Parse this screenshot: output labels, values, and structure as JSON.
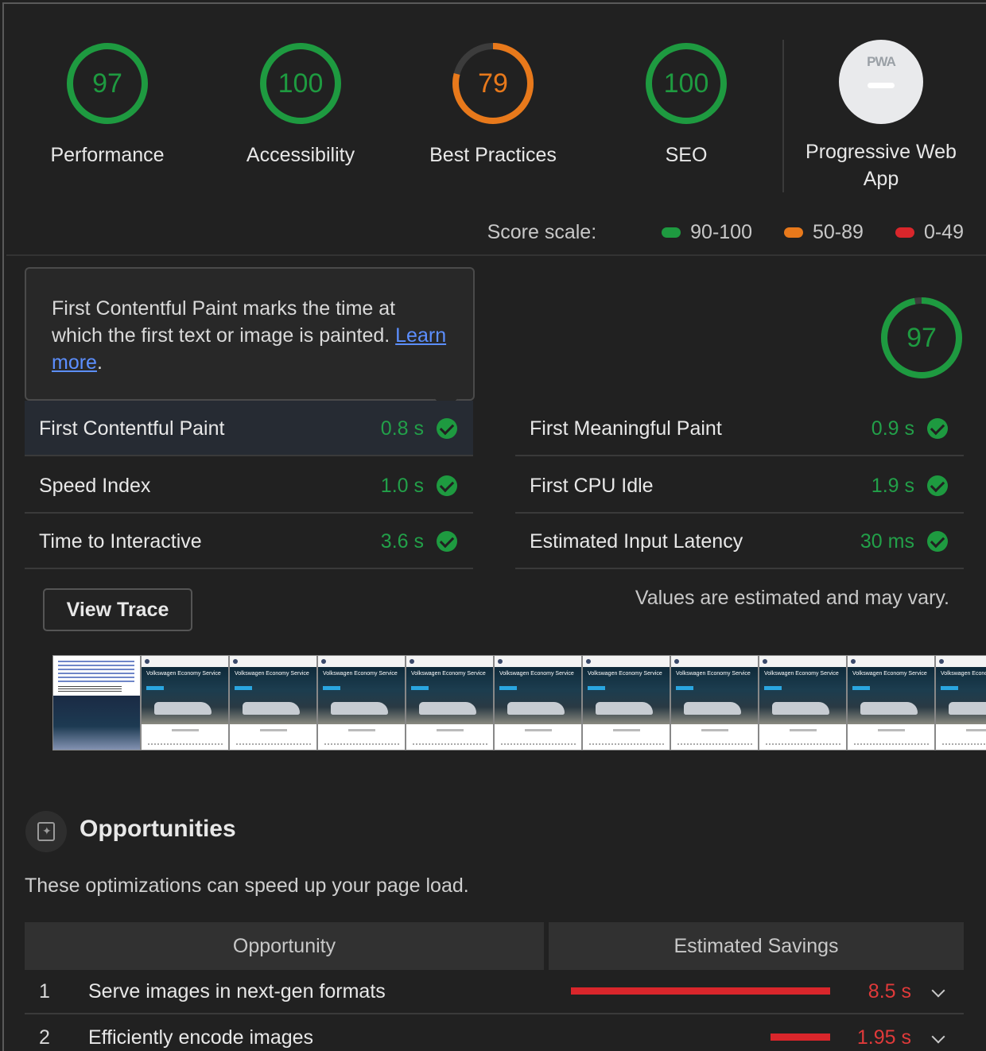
{
  "categories": [
    {
      "label": "Performance",
      "score": "97",
      "color": "#1e9a40"
    },
    {
      "label": "Accessibility",
      "score": "100",
      "color": "#1e9a40"
    },
    {
      "label": "Best Practices",
      "score": "79",
      "color": "#e8791b"
    },
    {
      "label": "SEO",
      "score": "100",
      "color": "#1e9a40"
    }
  ],
  "pwa": {
    "badge": "PWA",
    "label": "Progressive Web App"
  },
  "score_scale": {
    "label": "Score scale:",
    "ranges": [
      {
        "label": "90-100",
        "color": "#1e9a40"
      },
      {
        "label": "50-89",
        "color": "#e8791b"
      },
      {
        "label": "0-49",
        "color": "#d9262b"
      }
    ]
  },
  "tooltip": {
    "text": "First Contentful Paint marks the time at which the first text or image is painted.",
    "link": "Learn more",
    "suffix": "."
  },
  "performance_score": "97",
  "metrics": [
    {
      "name": "First Contentful Paint",
      "value": "0.8 s"
    },
    {
      "name": "First Meaningful Paint",
      "value": "0.9 s"
    },
    {
      "name": "Speed Index",
      "value": "1.0 s"
    },
    {
      "name": "First CPU Idle",
      "value": "1.9 s"
    },
    {
      "name": "Time to Interactive",
      "value": "3.6 s"
    },
    {
      "name": "Estimated Input Latency",
      "value": "30 ms"
    }
  ],
  "view_trace": "View Trace",
  "estimate_note": "Values are estimated and may vary.",
  "filmstrip_caption": "Volkswagen Economy Service",
  "opportunities": {
    "title": "Opportunities",
    "description": "These optimizations can speed up your page load.",
    "col_opportunity": "Opportunity",
    "col_savings": "Estimated Savings",
    "items": [
      {
        "index": "1",
        "name": "Serve images in next-gen formats",
        "savings": "8.5 s",
        "fraction": 1.0
      },
      {
        "index": "2",
        "name": "Efficiently encode images",
        "savings": "1.95 s",
        "fraction": 0.23
      }
    ]
  }
}
